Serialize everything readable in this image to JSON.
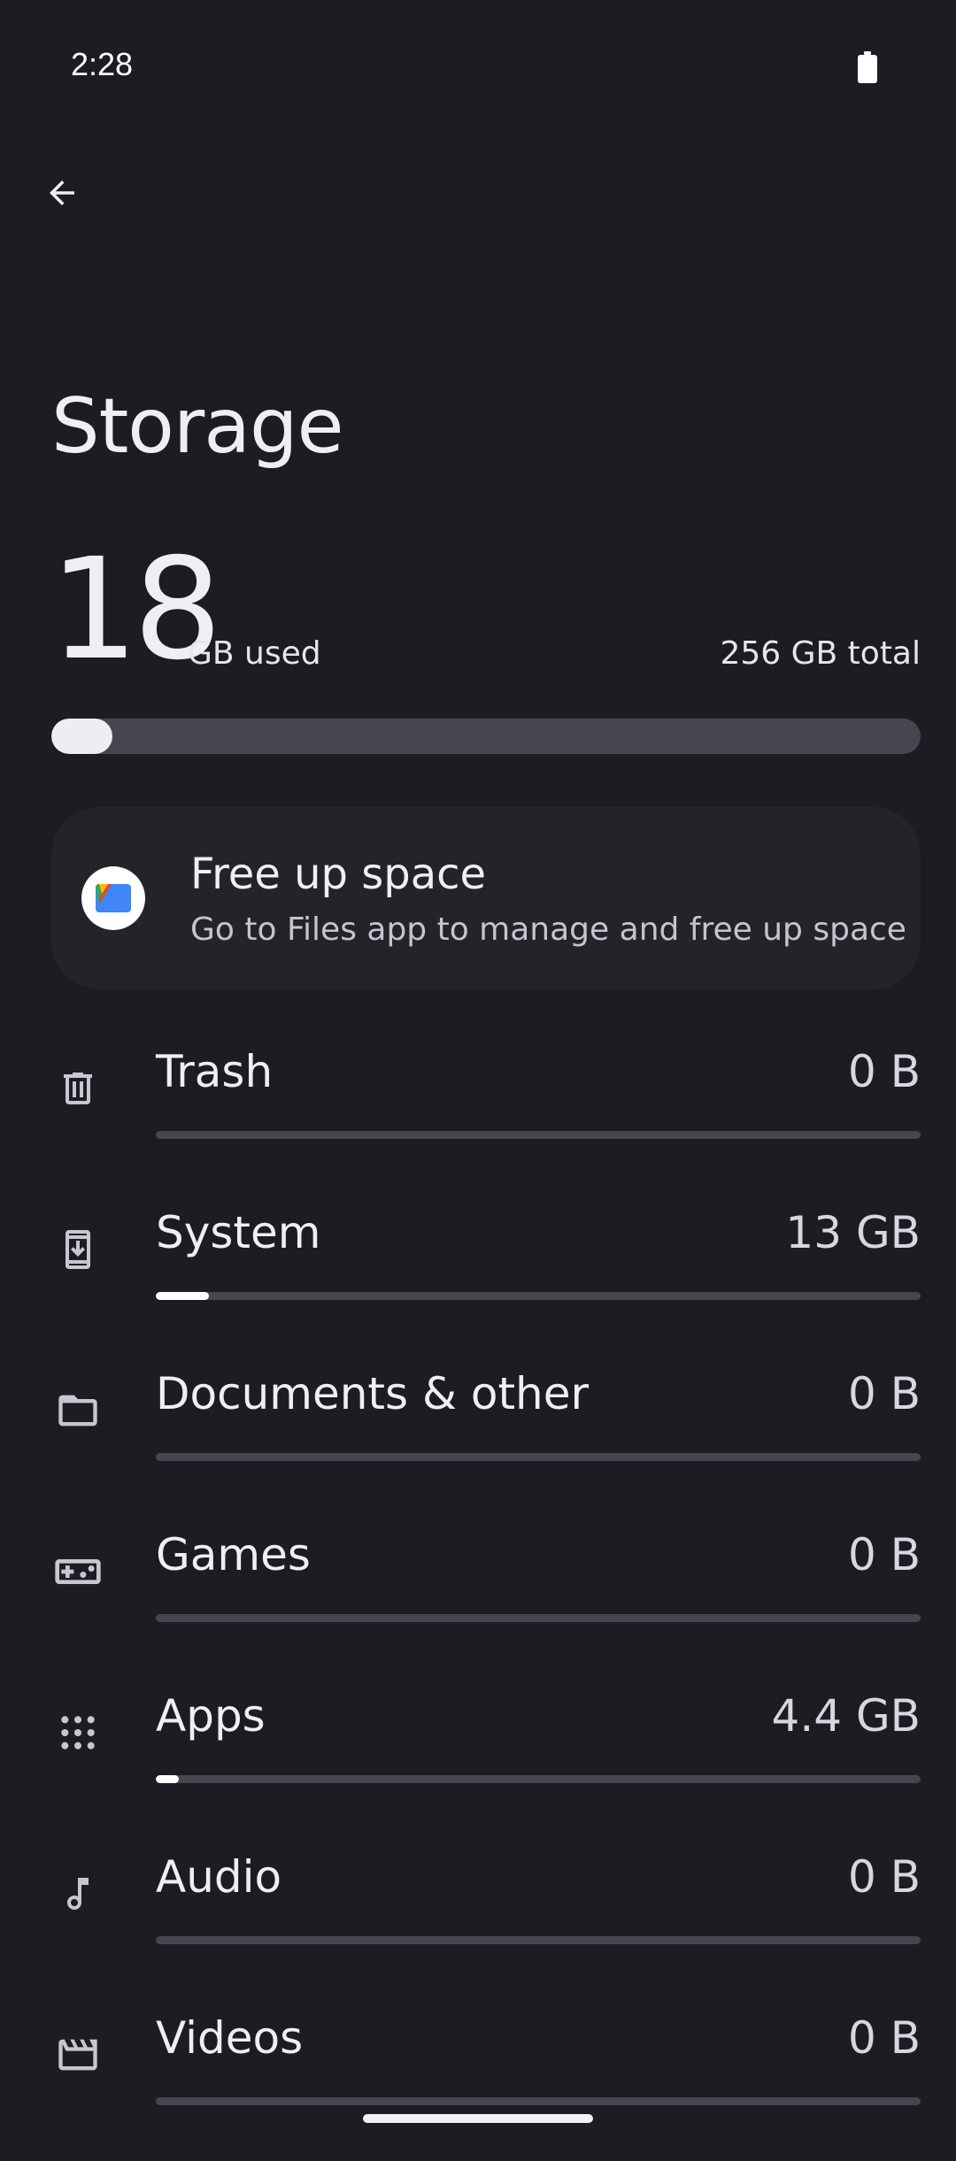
{
  "status_bar": {
    "time": "2:28",
    "battery_icon": "battery-full-icon"
  },
  "header": {
    "back_icon": "arrow-back-icon",
    "title": "Storage"
  },
  "summary": {
    "used_number": "18",
    "used_label": "GB used",
    "total_label": "256 GB total",
    "used_fraction": 0.0703
  },
  "free_up_card": {
    "icon": "files-app-icon",
    "title": "Free up space",
    "subtitle": "Go to Files app to manage and free up space"
  },
  "categories": [
    {
      "icon": "trash-icon",
      "label": "Trash",
      "value": "0 B",
      "fraction": 0.0
    },
    {
      "icon": "system-update-icon",
      "label": "System",
      "value": "13 GB",
      "fraction": 0.07
    },
    {
      "icon": "folder-icon",
      "label": "Documents & other",
      "value": "0 B",
      "fraction": 0.0
    },
    {
      "icon": "gamepad-icon",
      "label": "Games",
      "value": "0 B",
      "fraction": 0.0
    },
    {
      "icon": "apps-grid-icon",
      "label": "Apps",
      "value": "4.4 GB",
      "fraction": 0.03
    },
    {
      "icon": "music-note-icon",
      "label": "Audio",
      "value": "0 B",
      "fraction": 0.0
    },
    {
      "icon": "movie-icon",
      "label": "Videos",
      "value": "0 B",
      "fraction": 0.0
    }
  ],
  "colors": {
    "background": "#1d1c22",
    "card": "#242329",
    "bar_track": "#47464e",
    "bar_fill": "#eeedf4",
    "text_primary": "#f0eef5"
  }
}
